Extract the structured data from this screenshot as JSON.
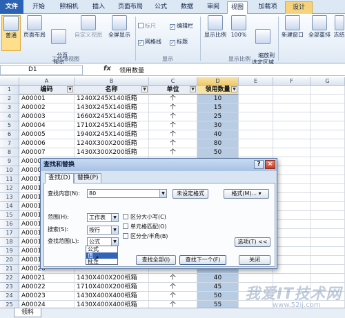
{
  "ribbon_tabs": [
    "文件",
    "开始",
    "照相机",
    "插入",
    "页面布局",
    "公式",
    "数据",
    "审阅",
    "视图",
    "加载项",
    "设计"
  ],
  "ribbon": {
    "normal": "普通",
    "page_layout": "页面布局",
    "page_break_preview": "分页\n预览",
    "custom_views": "自定义视图",
    "full_screen": "全屏显示",
    "group_views": "工作簿视图",
    "ruler": "标尺",
    "formula_bar": "编辑栏",
    "gridlines": "网格线",
    "headings": "标题",
    "group_show": "显示",
    "zoom": "显示比例",
    "zoom_100": "100%",
    "zoom_selection": "缩放到\n选定区域",
    "group_zoom": "显示比例",
    "new_window": "新建窗口",
    "arrange_all": "全部重排",
    "freeze": "冻结"
  },
  "formula_bar": {
    "name_box": "D1",
    "fx": "fx",
    "value": "领用数量"
  },
  "columns": [
    "A",
    "B",
    "C",
    "D",
    "E",
    "F",
    "G"
  ],
  "header_row": [
    "编码",
    "名称",
    "单位",
    "领用数量"
  ],
  "rows": [
    [
      "2",
      "A00001",
      "1240X245X140纸箱",
      "个",
      "10"
    ],
    [
      "3",
      "A00002",
      "1430X245X140纸箱",
      "个",
      "15"
    ],
    [
      "4",
      "A00003",
      "1660X245X140纸箱",
      "个",
      "25"
    ],
    [
      "5",
      "A00004",
      "1710X245X140纸箱",
      "个",
      "30"
    ],
    [
      "6",
      "A00005",
      "1940X245X140纸箱",
      "个",
      "40"
    ],
    [
      "7",
      "A00006",
      "1240X300X200纸箱",
      "个",
      "80"
    ],
    [
      "8",
      "A00007",
      "1430X300X200纸箱",
      "个",
      "50"
    ],
    [
      "9",
      "A00008",
      "",
      "",
      ""
    ],
    [
      "10",
      "A00009",
      "",
      "",
      ""
    ],
    [
      "11",
      "A00010",
      "",
      "",
      ""
    ],
    [
      "12",
      "A00011",
      "",
      "",
      ""
    ],
    [
      "13",
      "A00012",
      "",
      "",
      ""
    ],
    [
      "14",
      "A00013",
      "",
      "",
      ""
    ],
    [
      "15",
      "A00014",
      "",
      "",
      ""
    ],
    [
      "16",
      "A00015",
      "",
      "",
      ""
    ],
    [
      "17",
      "A00016",
      "",
      "",
      ""
    ],
    [
      "18",
      "A00017",
      "",
      "",
      ""
    ],
    [
      "19",
      "A00018",
      "",
      "",
      ""
    ],
    [
      "20",
      "A00019",
      "",
      "",
      ""
    ],
    [
      "21",
      "A00020",
      "",
      "",
      ""
    ],
    [
      "22",
      "A00021",
      "1430X400X200纸箱",
      "个",
      "40"
    ],
    [
      "23",
      "A00022",
      "1710X400X200纸箱",
      "个",
      "45"
    ],
    [
      "24",
      "A00023",
      "1430X400X400纸箱",
      "个",
      "50"
    ],
    [
      "25",
      "A00024",
      "1430X400X400纸箱",
      "个",
      "55"
    ]
  ],
  "sheet_tab": "领料",
  "dialog": {
    "title": "查找和替换",
    "help": "?",
    "close": "×",
    "tab_find": "查找(D)",
    "tab_replace": "替换(P)",
    "find_what_label": "查找内容(N):",
    "find_what_value": "80",
    "format_status": "未设定格式",
    "format_button": "格式(M)...",
    "within_label": "范围(H):",
    "within_value": "工作表",
    "search_label": "搜索(S):",
    "search_value": "按行",
    "look_in_label": "查找范围(L):",
    "look_in_value": "公式",
    "look_in_options": [
      "公式",
      "值",
      "批注"
    ],
    "match_case": "区分大小写(C)",
    "match_entire": "单元格匹配(O)",
    "match_byte": "区分全/半角(B)",
    "options_button": "选项(T) <<",
    "find_all": "查找全部(I)",
    "find_next": "查找下一个(F)",
    "close_button": "关闭"
  },
  "watermark": "我爱IT技术网",
  "watermark_url": "www.52ij.com"
}
